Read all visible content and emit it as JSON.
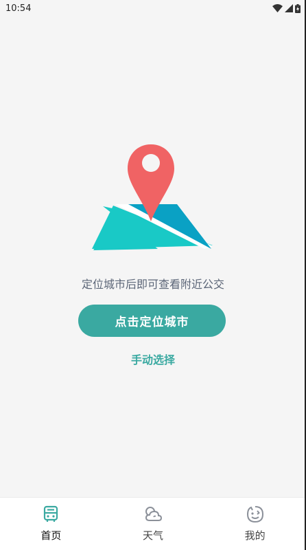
{
  "status_bar": {
    "time": "10:54",
    "icons": [
      "wifi-icon",
      "signal-icon",
      "battery-icon"
    ]
  },
  "empty_state": {
    "illustration": "map-pin-illustration",
    "hint": "定位城市后即可查看附近公交",
    "locate_button": "点击定位城市",
    "manual_link": "手动选择"
  },
  "bottom_nav": {
    "items": [
      {
        "label": "首页",
        "icon": "bus-icon",
        "active": true
      },
      {
        "label": "天气",
        "icon": "weather-icon",
        "active": false
      },
      {
        "label": "我的",
        "icon": "smiley-icon",
        "active": false
      }
    ]
  },
  "colors": {
    "accent": "#3aa9a1",
    "pin": "#f06364",
    "map_light": "#19c9c6",
    "map_dark": "#0aa1c4",
    "background": "#f5f5f5",
    "hint_text": "#5b6577"
  }
}
